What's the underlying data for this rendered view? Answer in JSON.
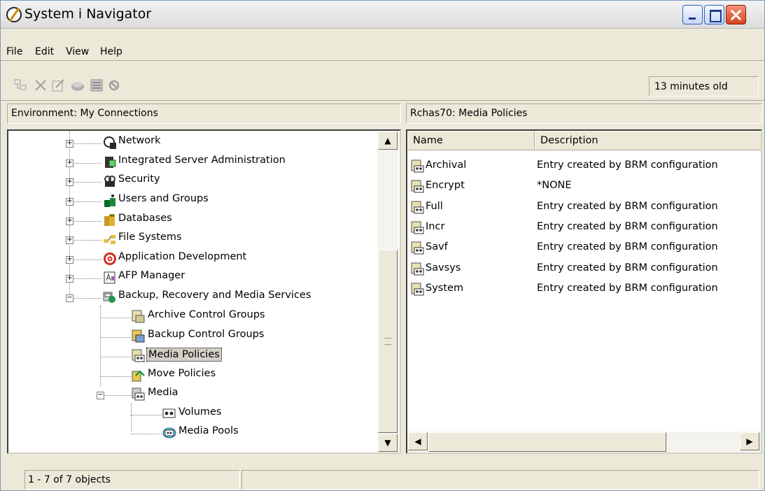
{
  "window": {
    "title": "System i Navigator"
  },
  "menu": {
    "items": [
      "File",
      "Edit",
      "View",
      "Help"
    ]
  },
  "toolbar": {
    "icons": [
      "properties-icon",
      "delete-icon",
      "edit-icon",
      "connect-icon",
      "view-icon",
      "stop-icon"
    ],
    "age_text": "13 minutes old"
  },
  "left_panel": {
    "header": "Environment: My Connections",
    "tree": [
      {
        "label": "Network",
        "icon": "network-icon",
        "expanded": false
      },
      {
        "label": "Integrated Server Administration",
        "icon": "server-admin-icon",
        "expanded": false
      },
      {
        "label": "Security",
        "icon": "security-icon",
        "expanded": false
      },
      {
        "label": "Users and Groups",
        "icon": "users-groups-icon",
        "expanded": false
      },
      {
        "label": "Databases",
        "icon": "database-icon",
        "expanded": false
      },
      {
        "label": "File Systems",
        "icon": "file-systems-icon",
        "expanded": false
      },
      {
        "label": "Application Development",
        "icon": "app-dev-icon",
        "expanded": false
      },
      {
        "label": "AFP Manager",
        "icon": "afp-manager-icon",
        "expanded": false
      },
      {
        "label": "Backup, Recovery and Media Services",
        "icon": "brms-icon",
        "expanded": true
      },
      {
        "label": "Archive Control Groups",
        "icon": "archive-control-icon"
      },
      {
        "label": "Backup Control Groups",
        "icon": "backup-control-icon"
      },
      {
        "label": "Media Policies",
        "icon": "media-policy-icon",
        "selected": true
      },
      {
        "label": "Move Policies",
        "icon": "move-policy-icon"
      },
      {
        "label": "Media",
        "icon": "media-icon",
        "expanded": true
      },
      {
        "label": "Volumes",
        "icon": "volumes-icon"
      },
      {
        "label": "Media Pools",
        "icon": "media-pools-icon"
      }
    ]
  },
  "right_panel": {
    "header": "Rchas70:  Media Policies",
    "columns": [
      "Name",
      "Description"
    ],
    "rows": [
      {
        "name": "Archival",
        "description": "Entry created by BRM configuration"
      },
      {
        "name": "Encrypt",
        "description": "*NONE"
      },
      {
        "name": "Full",
        "description": "Entry created by BRM configuration"
      },
      {
        "name": "Incr",
        "description": "Entry created by BRM configuration"
      },
      {
        "name": "Savf",
        "description": "Entry created by BRM configuration"
      },
      {
        "name": "Savsys",
        "description": "Entry created by BRM configuration"
      },
      {
        "name": "System",
        "description": "Entry created by BRM configuration"
      }
    ]
  },
  "status": {
    "count_text": "1 - 7 of 7 objects"
  }
}
